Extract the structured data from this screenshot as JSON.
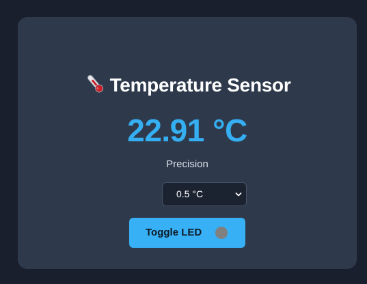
{
  "sensor": {
    "title": "Temperature Sensor",
    "title_icon": "thermometer-icon",
    "reading": "22.91 °C",
    "reading_color": "#35aef2"
  },
  "precision": {
    "label": "Precision",
    "selected": "0.5 °C"
  },
  "led": {
    "button_label": "Toggle LED",
    "indicator_color": "#808080"
  },
  "colors": {
    "background": "#1a1f2d",
    "card": "#2e3a4c",
    "accent": "#38b0f5"
  }
}
